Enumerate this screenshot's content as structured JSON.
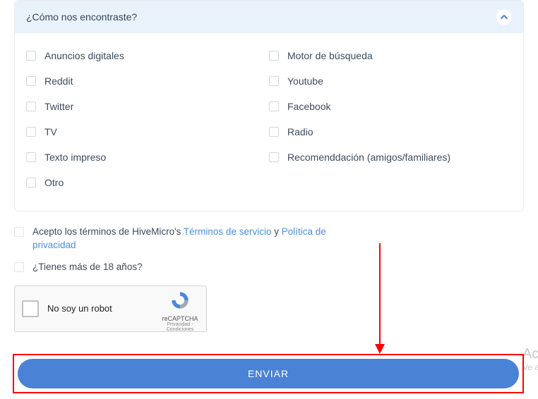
{
  "panel": {
    "title": "¿Cómo nos encontraste?",
    "left_options": [
      "Anuncios digitales",
      "Reddit",
      "Twitter",
      "TV",
      "Texto impreso",
      "Otro"
    ],
    "right_options": [
      "Motor de búsqueda",
      "Youtube",
      "Facebook",
      "Radio",
      "Recomenddación (amigos/familiares)"
    ]
  },
  "consent": {
    "terms_prefix": "Acepto los términos de HiveMicro's ",
    "terms_link": "Términos de servicio",
    "terms_join": " y ",
    "privacy_link": "Política de privacidad",
    "age_text": "¿Tienes más de 18 años?"
  },
  "recaptcha": {
    "label": "No soy un robot",
    "brand": "reCAPTCHA",
    "legal": "Privacidad - Condiciones"
  },
  "submit": {
    "label": "ENVIAR"
  },
  "partial": {
    "line1": "Ac",
    "line2": "Ve a"
  }
}
